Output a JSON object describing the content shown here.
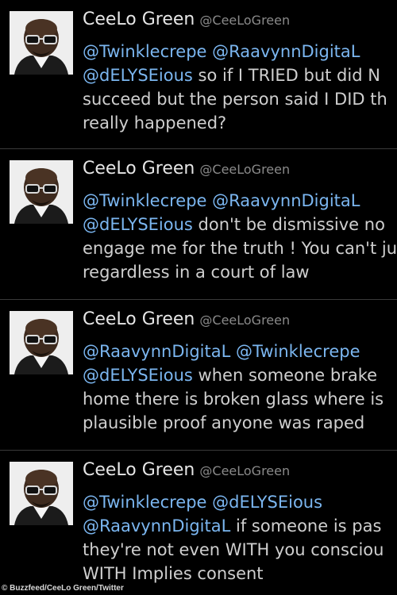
{
  "tweets": [
    {
      "name": "CeeLo Green",
      "handle": "@CeeLoGreen",
      "lines": [
        {
          "mentions": [
            "@Twinklecrepe",
            "@RaavynnDigitaL"
          ],
          "text": ""
        },
        {
          "mentions": [
            "@dELYSEious"
          ],
          "text": " so if I TRIED but did N"
        },
        {
          "mentions": [],
          "text": "succeed but the person said I DID th"
        },
        {
          "mentions": [],
          "text": "really happened?"
        }
      ]
    },
    {
      "name": "CeeLo Green",
      "handle": "@CeeLoGreen",
      "lines": [
        {
          "mentions": [
            "@Twinklecrepe",
            "@RaavynnDigitaL"
          ],
          "text": ""
        },
        {
          "mentions": [
            "@dELYSEious"
          ],
          "text": " don't be dismissive no"
        },
        {
          "mentions": [],
          "text": "engage me for the truth ! You can't ju"
        },
        {
          "mentions": [],
          "text": "regardless in a court of law"
        }
      ]
    },
    {
      "name": "CeeLo Green",
      "handle": "@CeeLoGreen",
      "lines": [
        {
          "mentions": [
            "@RaavynnDigitaL",
            "@Twinklecrepe"
          ],
          "text": ""
        },
        {
          "mentions": [
            "@dELYSEious"
          ],
          "text": " when someone brake"
        },
        {
          "mentions": [],
          "text": "home there is broken glass where is"
        },
        {
          "mentions": [],
          "text": "plausible proof anyone was raped"
        }
      ]
    },
    {
      "name": "CeeLo Green",
      "handle": "@CeeLoGreen",
      "lines": [
        {
          "mentions": [
            "@Twinklecrepe",
            "@dELYSEious"
          ],
          "text": ""
        },
        {
          "mentions": [
            "@RaavynnDigitaL"
          ],
          "text": " if someone is pas"
        },
        {
          "mentions": [],
          "text": "they're not even WITH you consciou"
        },
        {
          "mentions": [],
          "text": "WITH Implies consent"
        }
      ]
    }
  ],
  "credit": "© Buzzfeed/CeeLo Green/Twitter",
  "colors": {
    "background": "#000000",
    "mention": "#7bb6f0",
    "text": "#cfcfcf",
    "handle": "#8a8a8a"
  }
}
